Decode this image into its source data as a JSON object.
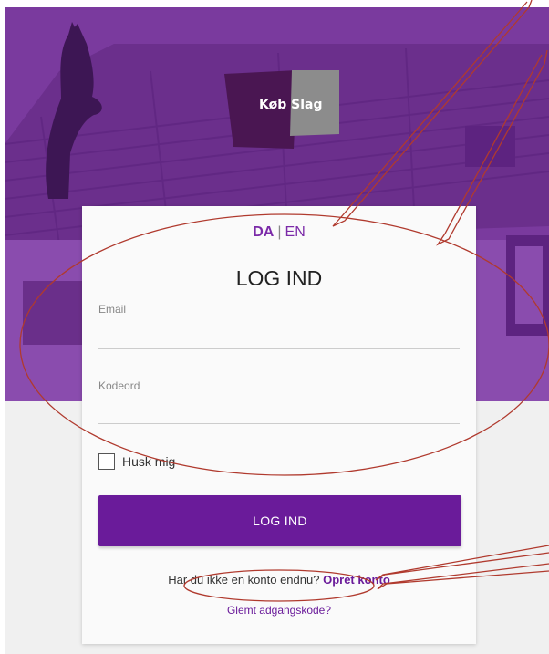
{
  "logo": {
    "text": "Køb Slag",
    "colors": {
      "left": "#4a1652",
      "right": "#8c8c8c"
    }
  },
  "language": {
    "active": "DA",
    "separator": "|",
    "other": "EN"
  },
  "login": {
    "title": "LOG IND",
    "email": {
      "label": "Email",
      "value": ""
    },
    "password": {
      "label": "Kodeord",
      "value": ""
    },
    "remember": {
      "label": "Husk mig",
      "checked": false
    },
    "submit_label": "LOG IND",
    "signup_prompt": "Har du ikke en konto endnu?",
    "signup_link": "Opret konto",
    "forgot_link": "Glemt adgangskode?"
  },
  "colors": {
    "brand": "#6a1b9a",
    "hero_overlay": "#7a3a9e",
    "annotation": "#b03a2e",
    "page_bg": "#f0f0f0"
  }
}
